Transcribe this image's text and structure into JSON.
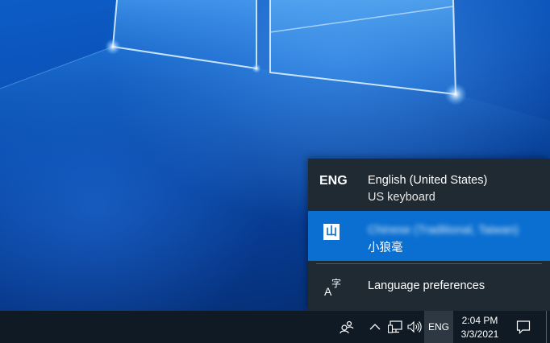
{
  "flyout": {
    "items": [
      {
        "code": "ENG",
        "language": "English (United States)",
        "keyboard": "US keyboard",
        "selected": false
      },
      {
        "icon_glyph": "山",
        "language": "Chinese (Traditional, Taiwan)",
        "keyboard": "小狼毫",
        "selected": true
      }
    ],
    "preferences_icon": "language-preferences-icon",
    "preferences_label": "Language preferences"
  },
  "taskbar": {
    "language_indicator": "ENG",
    "time": "2:04 PM",
    "date": "3/3/2021",
    "icons": [
      "people-icon",
      "chevron-up-icon",
      "network-icon",
      "volume-icon",
      "action-center-icon"
    ]
  },
  "colors": {
    "flyout_bg": "#1f2a33",
    "selected_bg": "#0a6fd1",
    "taskbar_bg": "#0f1a24",
    "wallpaper_blue": "#0a4fb3"
  }
}
